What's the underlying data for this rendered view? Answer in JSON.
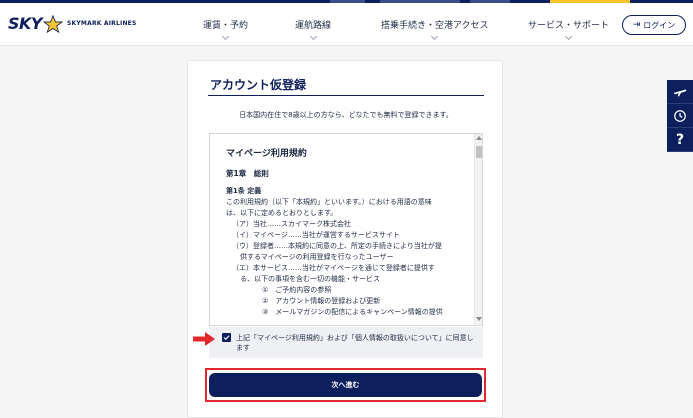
{
  "header": {
    "logo_sky": "SKY",
    "logo_text": "SKYMARK AIRLINES",
    "nav": [
      {
        "label": "運賃・予約"
      },
      {
        "label": "運航路線"
      },
      {
        "label": "搭乗手続き・空港アクセス"
      },
      {
        "label": "サービス・サポート"
      }
    ],
    "login_label": "ログイン"
  },
  "side_tabs": [
    {
      "icon": "airplane-icon"
    },
    {
      "icon": "clock-icon"
    },
    {
      "icon": "question-icon",
      "label": "?"
    }
  ],
  "card": {
    "title": "アカウント仮登録",
    "subtitle": "日本国内在住で8歳以上の方なら、どなたでも無料で登録できます。"
  },
  "terms": {
    "heading": "マイページ利用規約",
    "chapter": "第1章　総則",
    "article": "第1条 定義",
    "para": [
      "この利用規約（以下「本規約」といいます。）における用語の意味",
      "は、以下に定めるとおりとします。"
    ],
    "items": [
      {
        "text": "（ア）当社……スカイマーク株式会社",
        "level": 1
      },
      {
        "text": "（イ）マイページ……当社が運営するサービスサイト",
        "level": 1
      },
      {
        "text": "（ウ）登録者……本規約に同意の上、所定の手続きにより当社が提",
        "level": 1
      },
      {
        "text": "供するマイページの利用登録を行なったユーザー",
        "level": 2
      },
      {
        "text": "（エ）本サービス……当社がマイページを通じて登録者に提供す",
        "level": 1
      },
      {
        "text": "る、以下の事項を含む一切の機能・サービス",
        "level": 2
      },
      {
        "text": "①　ご予約内容の参照",
        "level": 3
      },
      {
        "text": "②　アカウント情報の登録および更新",
        "level": 3
      },
      {
        "text": "③　メールマガジンの配信によるキャンペーン情報の提供",
        "level": 3
      }
    ]
  },
  "agree": {
    "checked": true,
    "text": "上記「マイページ利用規約」および「個人情報の取扱いについて」に同意します"
  },
  "next_button_label": "次へ進む",
  "colors": {
    "navy": "#0d1f5c",
    "highlight_red": "#e0282e",
    "logo_star_yellow": "#f4c52a"
  }
}
